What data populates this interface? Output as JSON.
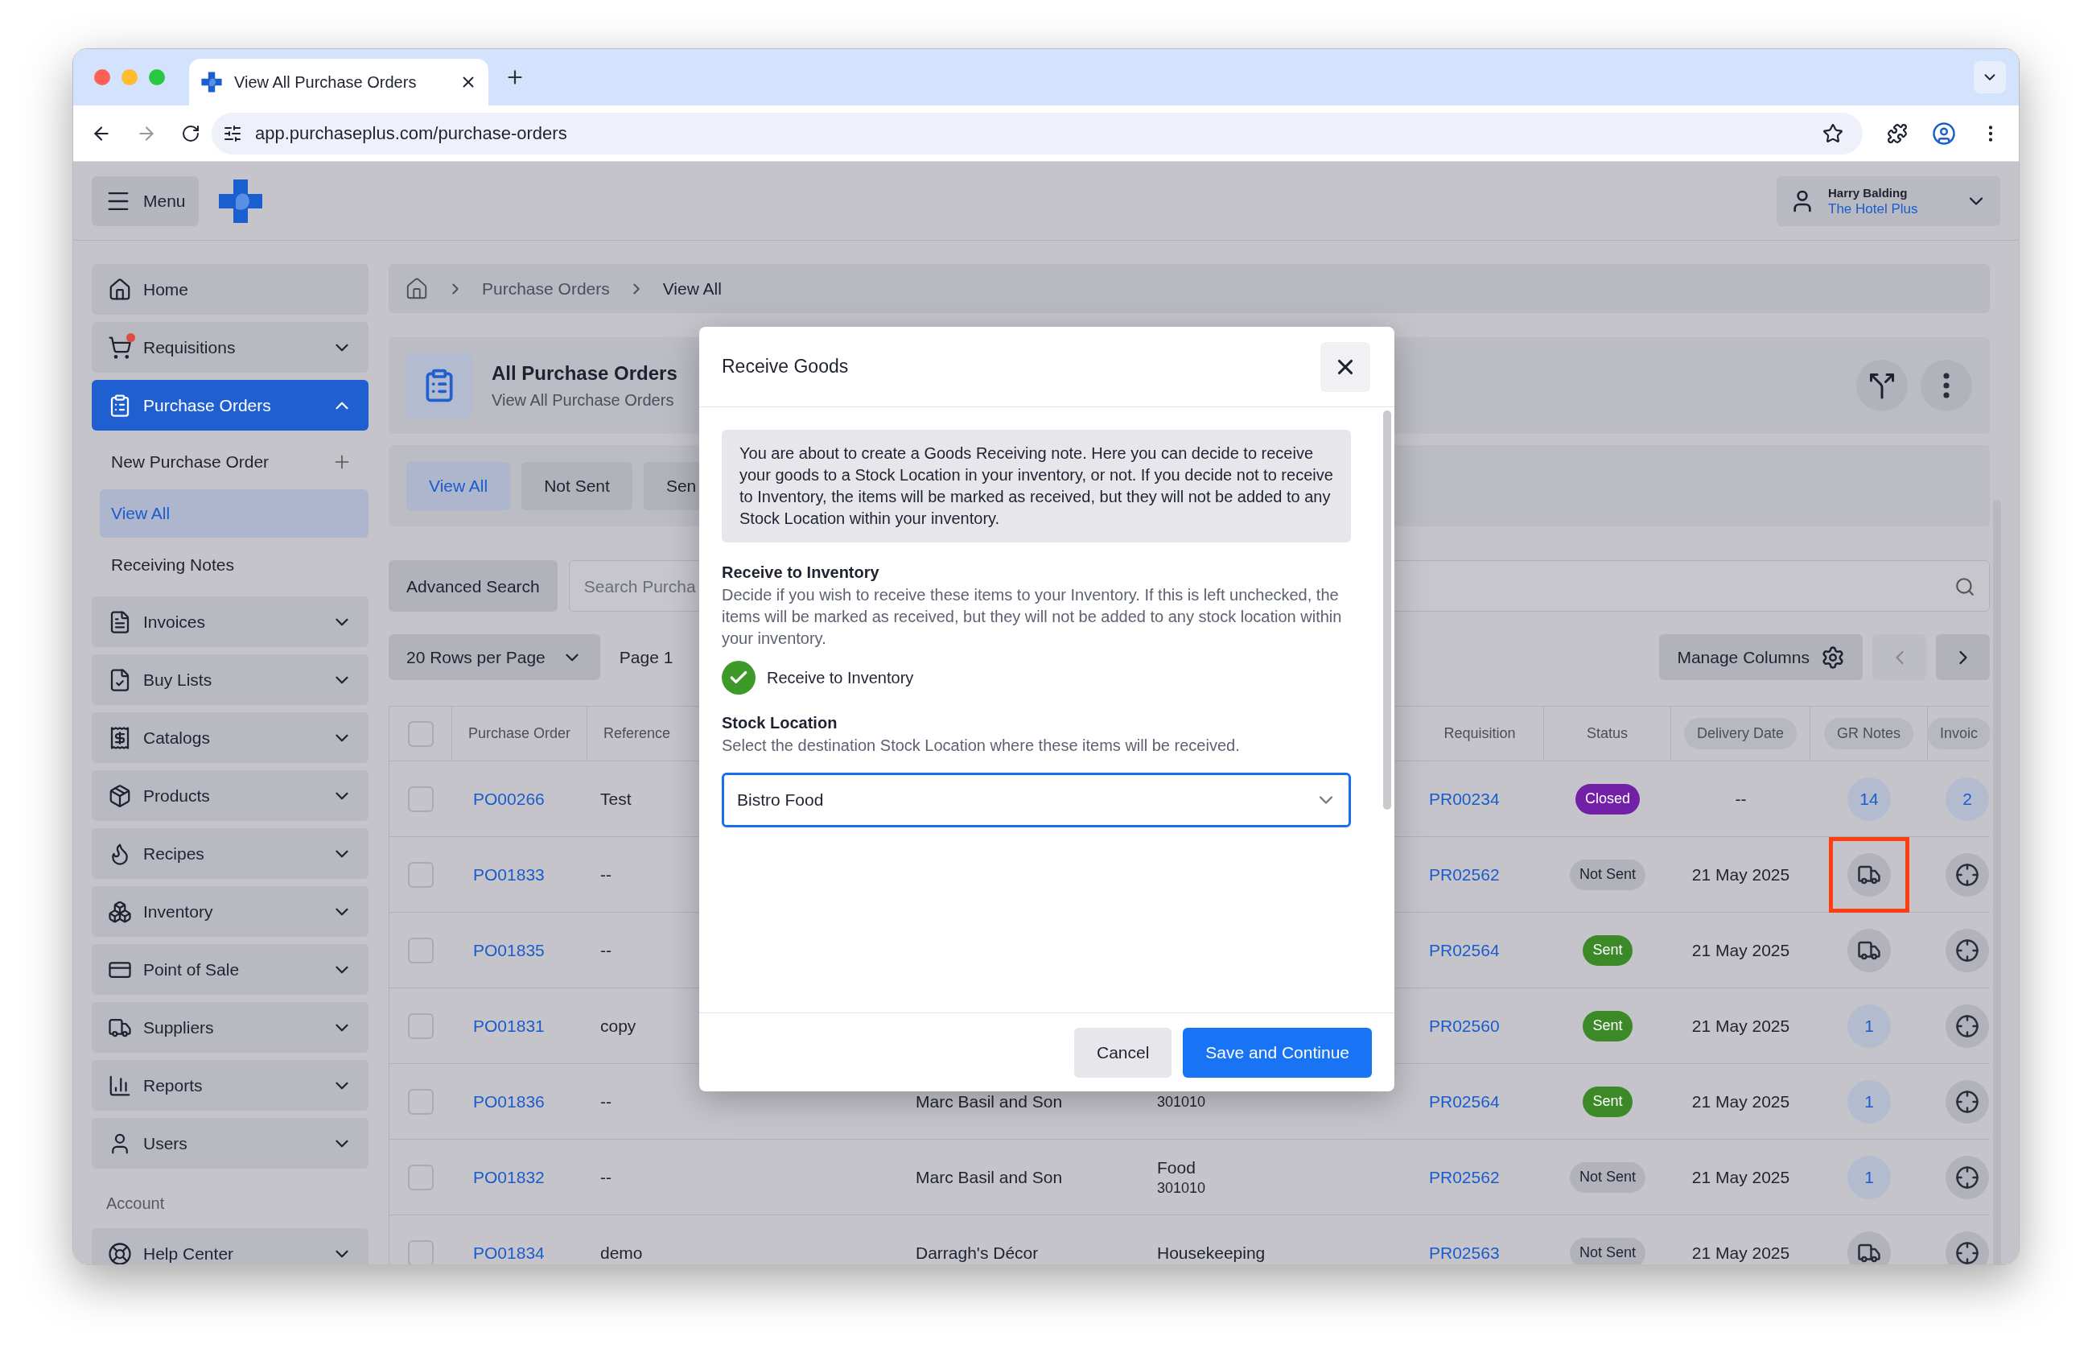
{
  "browser": {
    "tab_title": "View All Purchase Orders",
    "url": "app.purchaseplus.com/purchase-orders"
  },
  "header": {
    "menu_label": "Menu",
    "user_name": "Harry Balding",
    "organisation": "The Hotel Plus"
  },
  "sidebar": {
    "items": [
      {
        "label": "Home",
        "kind": "link",
        "selected": false,
        "alert": false
      },
      {
        "label": "Requisitions",
        "kind": "group",
        "selected": false,
        "expanded": false,
        "alert": true
      },
      {
        "label": "Purchase Orders",
        "kind": "group",
        "selected": true,
        "expanded": true,
        "alert": false,
        "children": [
          {
            "label": "New Purchase Order",
            "kind": "add",
            "selected": false
          },
          {
            "label": "View All",
            "kind": "link",
            "selected": true
          },
          {
            "label": "Receiving Notes",
            "kind": "link",
            "selected": false
          }
        ]
      },
      {
        "label": "Invoices",
        "kind": "group",
        "selected": false,
        "expanded": false,
        "alert": false
      },
      {
        "label": "Buy Lists",
        "kind": "group",
        "selected": false,
        "expanded": false,
        "alert": false
      },
      {
        "label": "Catalogs",
        "kind": "group",
        "selected": false,
        "expanded": false,
        "alert": false
      },
      {
        "label": "Products",
        "kind": "group",
        "selected": false,
        "expanded": false,
        "alert": false
      },
      {
        "label": "Recipes",
        "kind": "group",
        "selected": false,
        "expanded": false,
        "alert": false
      },
      {
        "label": "Inventory",
        "kind": "group",
        "selected": false,
        "expanded": false,
        "alert": false
      },
      {
        "label": "Point of Sale",
        "kind": "group",
        "selected": false,
        "expanded": false,
        "alert": false
      },
      {
        "label": "Suppliers",
        "kind": "group",
        "selected": false,
        "expanded": false,
        "alert": false
      },
      {
        "label": "Reports",
        "kind": "group",
        "selected": false,
        "expanded": false,
        "alert": false
      },
      {
        "label": "Users",
        "kind": "group",
        "selected": false,
        "expanded": false,
        "alert": false
      }
    ],
    "account_heading": "Account",
    "account_items": [
      {
        "label": "Help Center",
        "kind": "group",
        "selected": false,
        "expanded": false,
        "alert": false
      }
    ]
  },
  "breadcrumb": [
    "Purchase Orders",
    "View All"
  ],
  "page": {
    "title": "All Purchase Orders",
    "subtitle": "View All Purchase Orders"
  },
  "filter_tabs": [
    {
      "label": "View All",
      "selected": true
    },
    {
      "label": "Not Sent",
      "selected": false
    },
    {
      "label": "Sen",
      "selected": false
    }
  ],
  "search": {
    "advanced_label": "Advanced Search",
    "placeholder": "Search Purcha"
  },
  "pagination": {
    "rows_per_page": "20 Rows per Page",
    "page": "Page 1",
    "manage_columns": "Manage Columns"
  },
  "table": {
    "select_all_checked": false,
    "columns": [
      {
        "label": "Purchase Order",
        "kind": "plain"
      },
      {
        "label": "Reference",
        "kind": "plain"
      },
      {
        "label": "Requisition",
        "kind": "plain"
      },
      {
        "label": "Status",
        "kind": "plain"
      },
      {
        "label": "Delivery Date",
        "kind": "pill"
      },
      {
        "label": "GR Notes",
        "kind": "pill"
      },
      {
        "label": "Invoic",
        "kind": "pill"
      }
    ],
    "rows": [
      {
        "checked": false,
        "purchase_order": "PO00266",
        "reference": "Test",
        "requisition": "PR00234",
        "status": {
          "label": "Closed",
          "kind": "closed"
        },
        "delivery_date": "--",
        "gr_notes": {
          "kind": "count",
          "value": "14",
          "highlighted": false
        },
        "invoices": {
          "kind": "count",
          "value": "2"
        }
      },
      {
        "checked": false,
        "purchase_order": "PO01833",
        "reference": "--",
        "requisition": "PR02562",
        "status": {
          "label": "Not Sent",
          "kind": "not_sent"
        },
        "delivery_date": "21 May 2025",
        "gr_notes": {
          "kind": "truck",
          "highlighted": true
        },
        "invoices": {
          "kind": "crosshair"
        }
      },
      {
        "checked": false,
        "purchase_order": "PO01835",
        "reference": "--",
        "requisition": "PR02564",
        "status": {
          "label": "Sent",
          "kind": "sent"
        },
        "delivery_date": "21 May 2025",
        "gr_notes": {
          "kind": "truck",
          "highlighted": false
        },
        "invoices": {
          "kind": "crosshair"
        }
      },
      {
        "checked": false,
        "purchase_order": "PO01831",
        "reference": "copy",
        "requisition": "PR02560",
        "status": {
          "label": "Sent",
          "kind": "sent"
        },
        "delivery_date": "21 May 2025",
        "gr_notes": {
          "kind": "count",
          "value": "1",
          "highlighted": false
        },
        "invoices": {
          "kind": "crosshair"
        }
      },
      {
        "checked": false,
        "purchase_order": "PO01836",
        "reference": "--",
        "supplier": "Marc Basil and Son",
        "category_code": "301010",
        "requisition": "PR02564",
        "status": {
          "label": "Sent",
          "kind": "sent"
        },
        "delivery_date": "21 May 2025",
        "gr_notes": {
          "kind": "count",
          "value": "1",
          "highlighted": false
        },
        "invoices": {
          "kind": "crosshair"
        }
      },
      {
        "checked": false,
        "purchase_order": "PO01832",
        "reference": "--",
        "supplier": "Marc Basil and Son",
        "category": "Food",
        "category_code": "301010",
        "requisition": "PR02562",
        "status": {
          "label": "Not Sent",
          "kind": "not_sent"
        },
        "delivery_date": "21 May 2025",
        "gr_notes": {
          "kind": "count",
          "value": "1",
          "highlighted": false
        },
        "invoices": {
          "kind": "crosshair"
        }
      },
      {
        "checked": false,
        "purchase_order": "PO01834",
        "reference": "demo",
        "supplier": "Darragh's Décor",
        "category": "Housekeeping",
        "requisition": "PR02563",
        "status": {
          "label": "Not Sent",
          "kind": "not_sent"
        },
        "delivery_date": "21 May 2025",
        "gr_notes": {
          "kind": "truck",
          "highlighted": false
        },
        "invoices": {
          "kind": "crosshair"
        }
      }
    ]
  },
  "modal": {
    "title": "Receive Goods",
    "info": "You are about to create a Goods Receiving note. Here you can decide to receive your goods to a Stock Location in your inventory, or not. If you decide not to receive to Inventory, the items will be marked as received, but they will not be added to any Stock Location within your inventory.",
    "inventory_heading": "Receive to Inventory",
    "inventory_description": "Decide if you wish to receive these items to your Inventory. If this is left unchecked, the items will be marked as received, but they will not be added to any stock location within your inventory.",
    "checkbox": {
      "label": "Receive to Inventory",
      "checked": true
    },
    "location_heading": "Stock Location",
    "location_description": "Select the destination Stock Location where these items will be received.",
    "location_value": "Bistro Food",
    "buttons": [
      {
        "label": "Cancel",
        "kind": "secondary"
      },
      {
        "label": "Save and Continue",
        "kind": "primary"
      }
    ]
  }
}
